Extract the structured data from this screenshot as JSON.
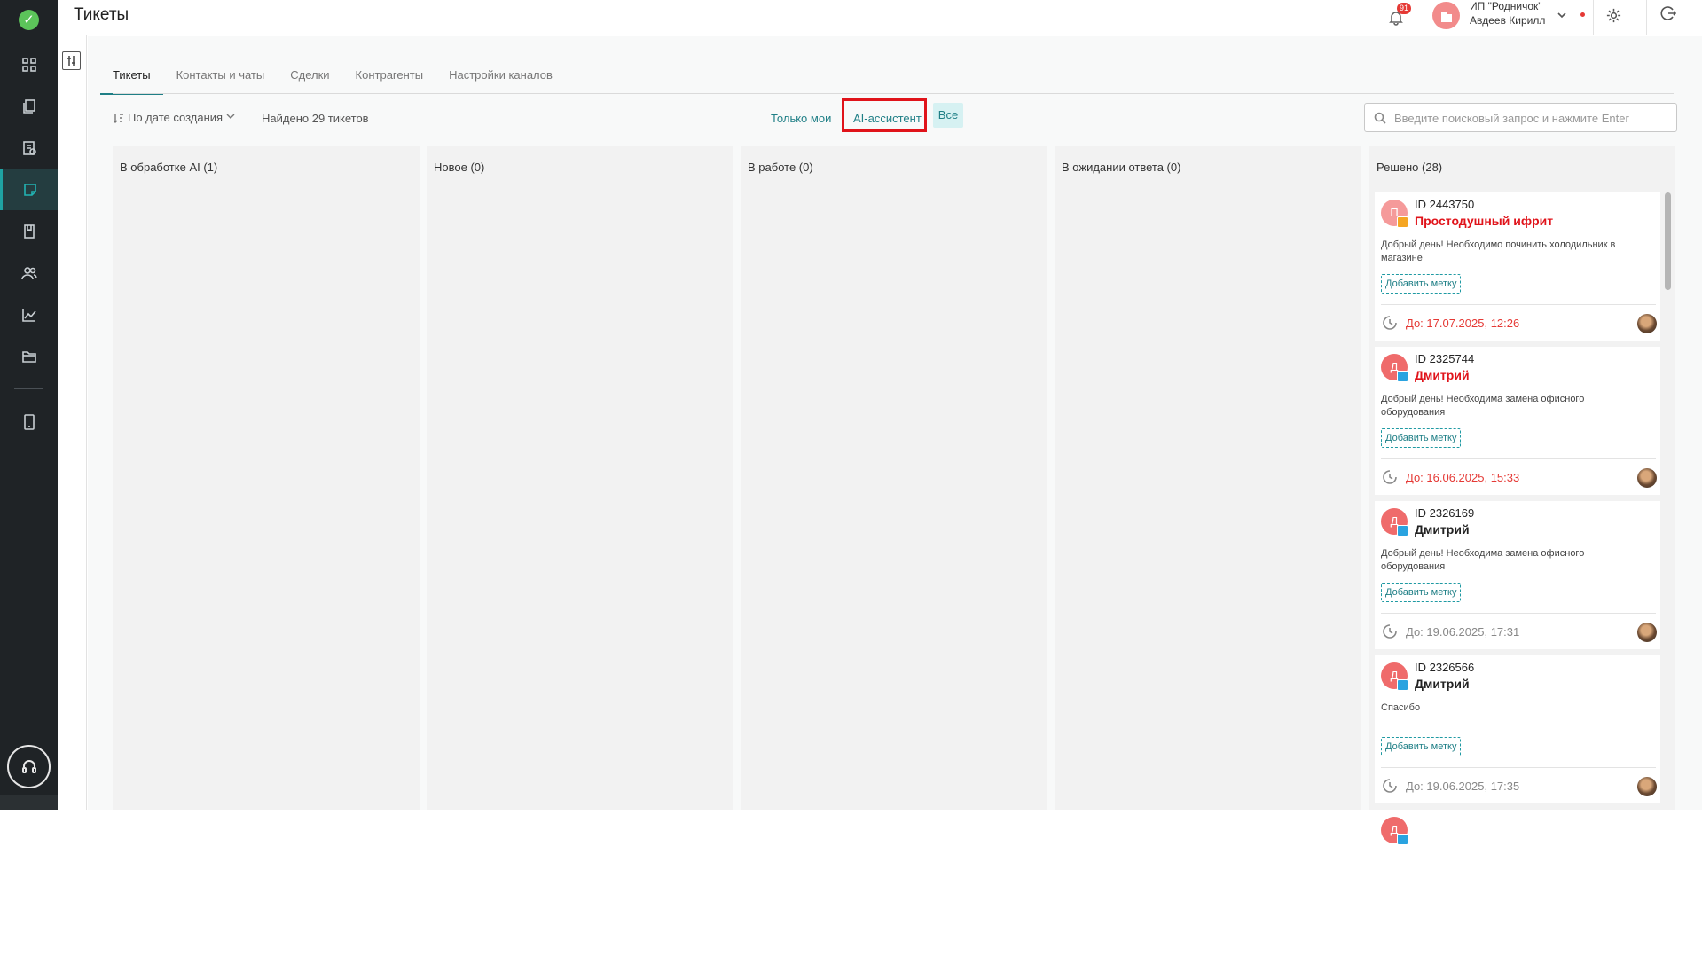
{
  "header": {
    "title": "Тикеты",
    "notifications_count": "91",
    "company": "ИП \"Родничок\"",
    "user": "Авдеев Кирилл"
  },
  "tabs": [
    {
      "label": "Тикеты",
      "active": true
    },
    {
      "label": "Контакты и чаты",
      "active": false
    },
    {
      "label": "Сделки",
      "active": false
    },
    {
      "label": "Контрагенты",
      "active": false
    },
    {
      "label": "Настройки каналов",
      "active": false
    }
  ],
  "toolbar": {
    "sort_label": "По дате создания",
    "found_label": "Найдено 29 тикетов",
    "only_mine": "Только мои",
    "ai_assistant": "AI-ассистент",
    "all": "Все",
    "search_placeholder": "Введите поисковый запрос и нажмите Enter"
  },
  "columns": [
    {
      "title": "В обработке AI (1)"
    },
    {
      "title": "Новое (0)"
    },
    {
      "title": "В работе (0)"
    },
    {
      "title": "В ожидании ответа (0)"
    },
    {
      "title": "Решено (28)"
    }
  ],
  "cards": [
    {
      "initial": "П",
      "avatar_color": "#f59a9a",
      "channel": "chat-icon",
      "channel_color": "#f5a623",
      "id": "ID 2443750",
      "name": "Простодушный ифрит",
      "name_color": "#e0131a",
      "text": "Добрый день! Необходимо починить холодильник в магазине",
      "tag": "Добавить метку",
      "due": "До: 17.07.2025, 12:26",
      "due_color": "#e53935"
    },
    {
      "initial": "Д",
      "avatar_color": "#ef6b6b",
      "channel": "telegram-icon",
      "channel_color": "#2aa3e0",
      "id": "ID 2325744",
      "name": "Дмитрий",
      "name_color": "#e0131a",
      "text": "Добрый день! Необходима замена офисного оборудования",
      "tag": "Добавить метку",
      "due": "До: 16.06.2025, 15:33",
      "due_color": "#e53935"
    },
    {
      "initial": "Д",
      "avatar_color": "#ef6b6b",
      "channel": "telegram-icon",
      "channel_color": "#2aa3e0",
      "id": "ID 2326169",
      "name": "Дмитрий",
      "name_color": "#222222",
      "text": "Добрый день! Необходима замена офисного оборудования",
      "tag": "Добавить метку",
      "due": "До: 19.06.2025, 17:31",
      "due_color": "#888888"
    },
    {
      "initial": "Д",
      "avatar_color": "#ef6b6b",
      "channel": "telegram-icon",
      "channel_color": "#2aa3e0",
      "id": "ID 2326566",
      "name": "Дмитрий",
      "name_color": "#222222",
      "text": "Спасибо",
      "tag": "Добавить метку",
      "due": "До: 19.06.2025, 17:35",
      "due_color": "#888888"
    },
    {
      "initial": "Д",
      "avatar_color": "#ef6b6b",
      "channel": "telegram-icon",
      "channel_color": "#2aa3e0",
      "id": "",
      "name": "",
      "name_color": "#222222",
      "text": "",
      "tag": "",
      "due": "",
      "due_color": "#888888"
    }
  ]
}
